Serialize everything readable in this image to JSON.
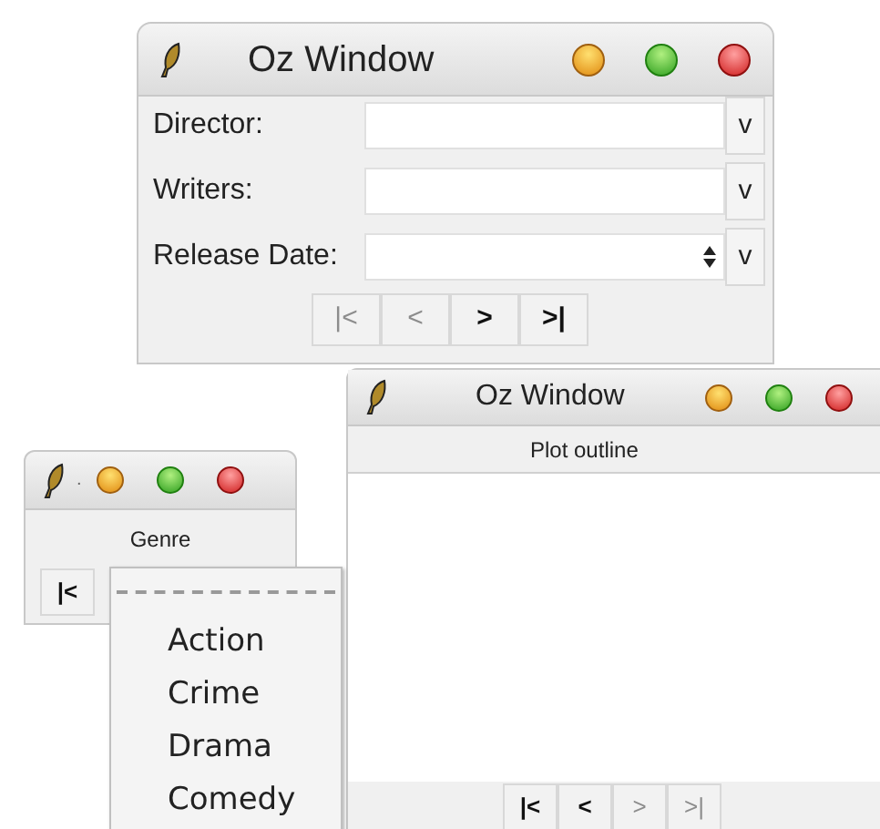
{
  "windows": [
    {
      "title": "Oz Window",
      "fields": [
        {
          "label": "Director:",
          "kind": "text",
          "dropdown": "v"
        },
        {
          "label": "Writers:",
          "kind": "text",
          "dropdown": "v"
        },
        {
          "label": "Release Date:",
          "kind": "spin",
          "dropdown": "v"
        }
      ],
      "nav": [
        {
          "label": "|<",
          "disabled": true
        },
        {
          "label": "<",
          "disabled": true
        },
        {
          "label": ">",
          "disabled": false
        },
        {
          "label": ">|",
          "disabled": false
        }
      ]
    },
    {
      "title": "Oz Window",
      "heading": "Plot outline",
      "nav": [
        {
          "label": "|<",
          "disabled": false
        },
        {
          "label": "<",
          "disabled": false
        },
        {
          "label": ">",
          "disabled": true
        },
        {
          "label": ">|",
          "disabled": true
        }
      ]
    },
    {
      "title": ".",
      "heading": "Genre",
      "nav": [
        {
          "label": "|<",
          "disabled": false
        }
      ]
    }
  ],
  "menu": {
    "items": [
      "Action",
      "Crime",
      "Drama",
      "Comedy"
    ]
  }
}
